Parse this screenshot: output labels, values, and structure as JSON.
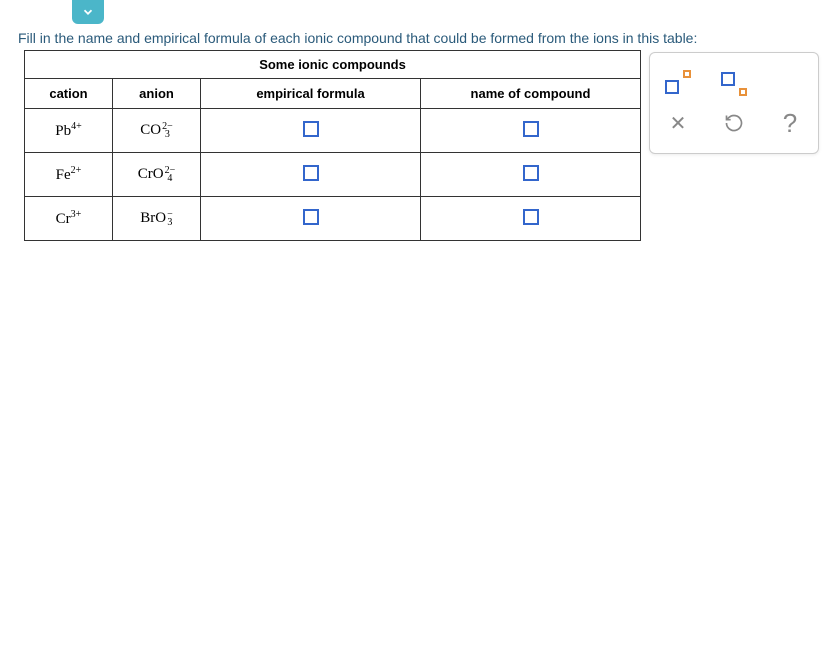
{
  "instruction": "Fill in the name and empirical formula of each ionic compound that could be formed from the ions in this table:",
  "table": {
    "title": "Some ionic compounds",
    "headers": {
      "cation": "cation",
      "anion": "anion",
      "formula": "empirical formula",
      "name": "name of compound"
    },
    "rows": [
      {
        "cation_base": "Pb",
        "cation_charge": "4+",
        "anion_base": "CO",
        "anion_sup": "2−",
        "anion_sub": "3"
      },
      {
        "cation_base": "Fe",
        "cation_charge": "2+",
        "anion_base": "CrO",
        "anion_sup": "2−",
        "anion_sub": "4"
      },
      {
        "cation_base": "Cr",
        "cation_charge": "3+",
        "anion_base": "BrO",
        "anion_sup": "−",
        "anion_sub": "3"
      }
    ]
  },
  "tools": {
    "close": "✕",
    "reset": "↺",
    "help": "?"
  }
}
